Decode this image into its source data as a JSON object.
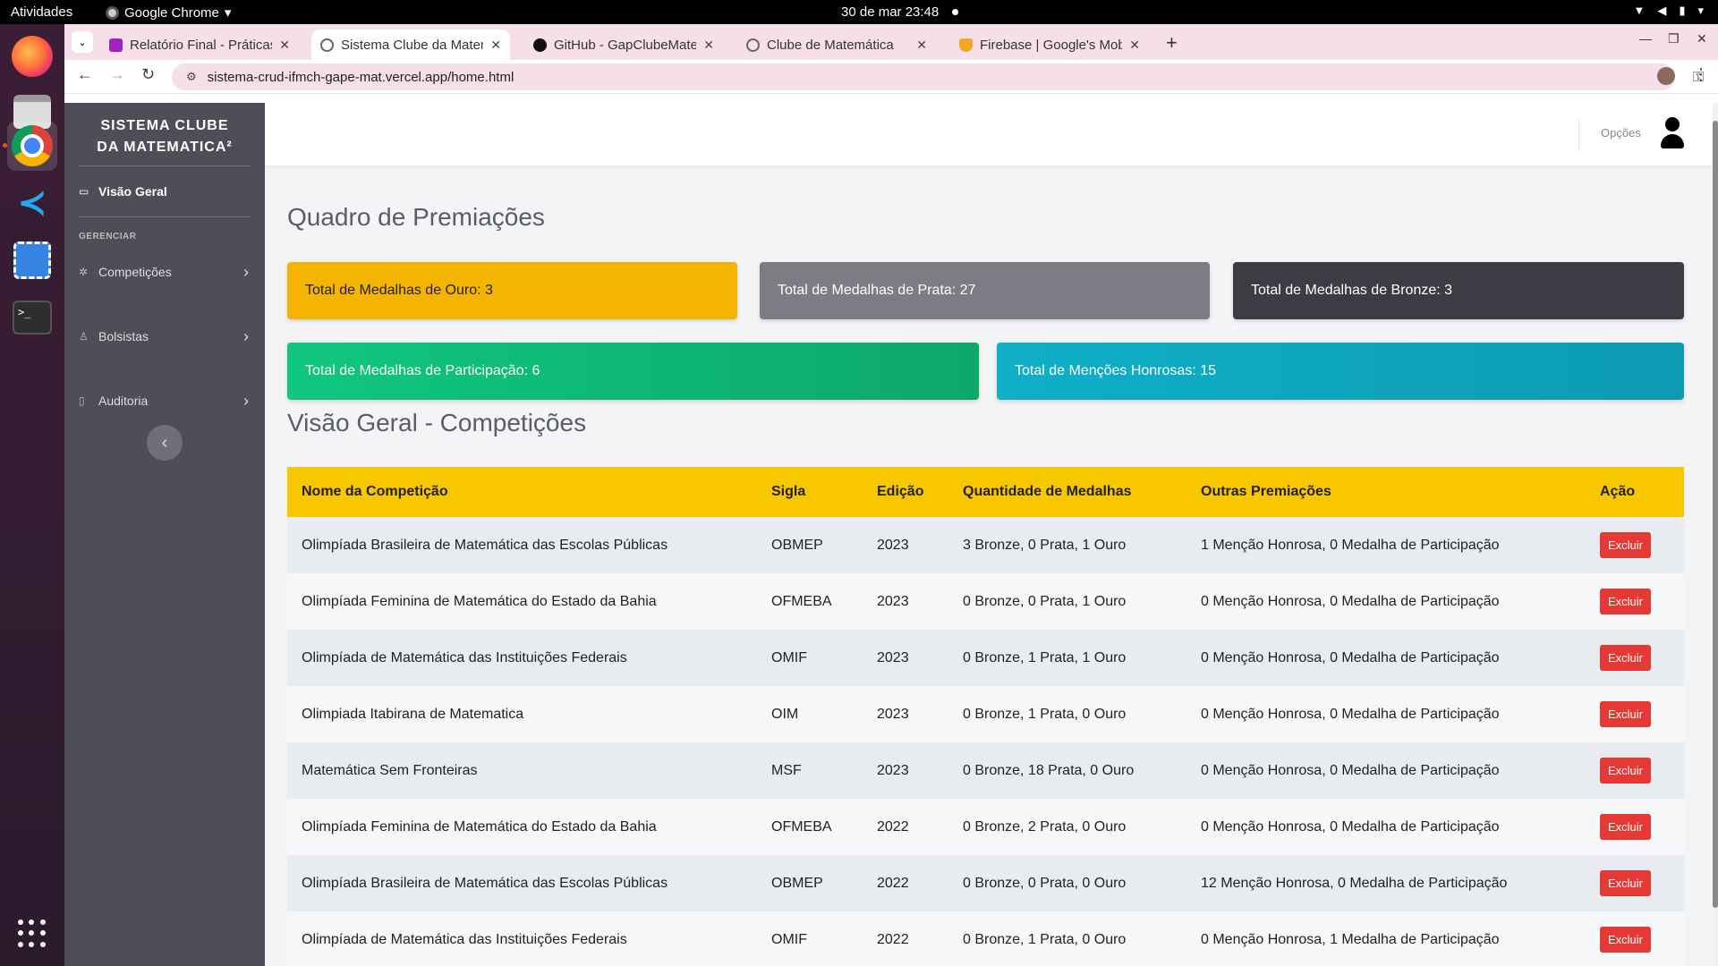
{
  "system": {
    "activities": "Atividades",
    "app_name": "Google Chrome",
    "clock": "30 de mar  23:48"
  },
  "browser": {
    "tabs": [
      {
        "title": "Relatório Final - Práticas",
        "color": "#a020c0"
      },
      {
        "title": "Sistema Clube da Matem",
        "color": "#666666"
      },
      {
        "title": "GitHub - GapClubeMater",
        "color": "#111111"
      },
      {
        "title": "Clube de Matemática",
        "color": "#666666"
      },
      {
        "title": "Firebase | Google's Mobi",
        "color": "#f5a623"
      }
    ],
    "url": "sistema-crud-ifmch-gape-mat.vercel.app/home.html"
  },
  "sidebar": {
    "brand_line1": "SISTEMA CLUBE",
    "brand_line2": "DA MATEMATICA²",
    "overview": "Visão Geral",
    "heading": "GERENCIAR",
    "items": [
      {
        "label": "Competições"
      },
      {
        "label": "Bolsistas"
      },
      {
        "label": "Auditoria"
      }
    ]
  },
  "topnav": {
    "options": "Opções"
  },
  "awards": {
    "title": "Quadro de Premiações",
    "cards": [
      {
        "label": "Total de Medalhas de Ouro: 3",
        "color": "#f4b400"
      },
      {
        "label": "Total de Medalhas de Prata: 27",
        "color": "#7d7c85"
      },
      {
        "label": "Total de Medalhas de Bronze: 3",
        "color": "#3d3c45"
      },
      {
        "label": "Total de Medalhas de Participação: 6",
        "color": "#10c77f"
      },
      {
        "label": "Total de Menções Honrosas: 15",
        "color": "#0fb0c8"
      }
    ]
  },
  "overview": {
    "title": "Visão Geral - Competições",
    "headers": [
      "Nome da Competição",
      "Sigla",
      "Edição",
      "Quantidade de Medalhas",
      "Outras Premiações",
      "Ação"
    ],
    "delete_label": "Excluir",
    "rows": [
      {
        "name": "Olimpíada Brasileira de Matemática das Escolas Públicas",
        "acronym": "OBMEP",
        "edition": "2023",
        "medals": "3 Bronze, 0 Prata, 1 Ouro",
        "other": "1 Menção Honrosa, 0 Medalha de Participação"
      },
      {
        "name": "Olimpíada Feminina de Matemática do Estado da Bahia",
        "acronym": "OFMEBA",
        "edition": "2023",
        "medals": "0 Bronze, 0 Prata, 1 Ouro",
        "other": "0 Menção Honrosa, 0 Medalha de Participação"
      },
      {
        "name": "Olimpíada de Matemática das Instituições Federais",
        "acronym": "OMIF",
        "edition": "2023",
        "medals": "0 Bronze, 1 Prata, 1 Ouro",
        "other": "0 Menção Honrosa, 0 Medalha de Participação"
      },
      {
        "name": "Olimpiada Itabirana de Matematica",
        "acronym": "OIM",
        "edition": "2023",
        "medals": "0 Bronze, 1 Prata, 0 Ouro",
        "other": "0 Menção Honrosa, 0 Medalha de Participação"
      },
      {
        "name": "Matemática Sem Fronteiras",
        "acronym": "MSF",
        "edition": "2023",
        "medals": "0 Bronze, 18 Prata, 0 Ouro",
        "other": "0 Menção Honrosa, 0 Medalha de Participação"
      },
      {
        "name": "Olimpíada Feminina de Matemática do Estado da Bahia",
        "acronym": "OFMEBA",
        "edition": "2022",
        "medals": "0 Bronze, 2 Prata, 0 Ouro",
        "other": "0 Menção Honrosa, 0 Medalha de Participação"
      },
      {
        "name": "Olimpíada Brasileira de Matemática das Escolas Públicas",
        "acronym": "OBMEP",
        "edition": "2022",
        "medals": "0 Bronze, 0 Prata, 0 Ouro",
        "other": "12 Menção Honrosa, 0 Medalha de Participação"
      },
      {
        "name": "Olimpíada de Matemática das Instituições Federais",
        "acronym": "OMIF",
        "edition": "2022",
        "medals": "0 Bronze, 1 Prata, 0 Ouro",
        "other": "0 Menção Honrosa, 1 Medalha de Participação"
      }
    ]
  }
}
